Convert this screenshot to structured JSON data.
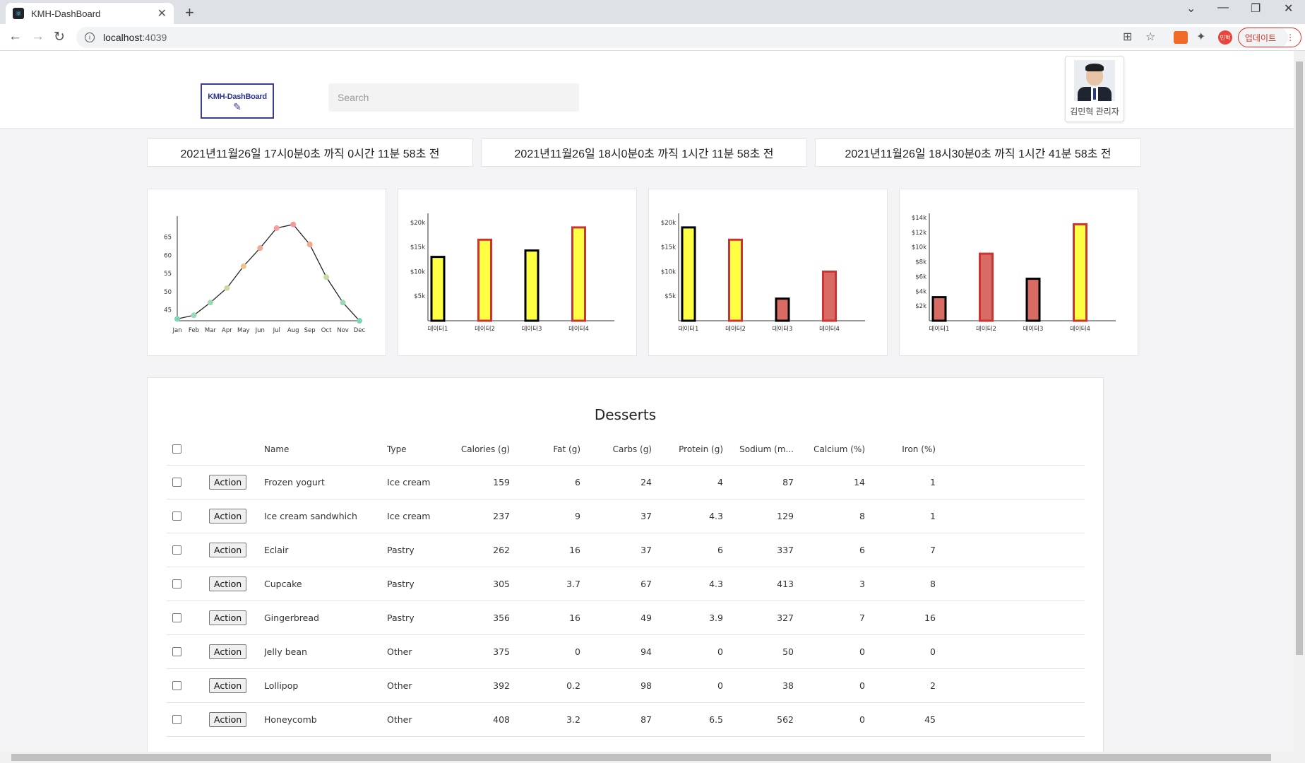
{
  "browser": {
    "tab_title": "KMH-DashBoard",
    "url_host": "localhost",
    "url_port": ":4039",
    "update_label": "업데이트",
    "profile_label": "민혁"
  },
  "header": {
    "logo_text": "KMH-DashBoard",
    "search_placeholder": "Search",
    "user_name": "김민혁 관리자"
  },
  "timers": [
    "2021년11월26일 17시0분0초 까직  0시간 11분 58초 전",
    "2021년11월26일 18시0분0초 까직  1시간 11분 58초 전",
    "2021년11월26일 18시30분0초 까직  1시간 41분 58초 전"
  ],
  "chart_data": [
    {
      "type": "line",
      "categories": [
        "Jan",
        "Feb",
        "Mar",
        "Apr",
        "May",
        "Jun",
        "Jul",
        "Aug",
        "Sep",
        "Oct",
        "Nov",
        "Dec"
      ],
      "values": [
        42.5,
        43.5,
        47,
        51,
        57,
        62,
        67.5,
        68.5,
        63,
        54,
        47,
        42
      ],
      "ylim": [
        42,
        70
      ],
      "yticks": [
        45,
        50,
        55,
        60,
        65
      ],
      "point_colors": [
        "#7ed6b2",
        "#9ad9b8",
        "#9fd8b4",
        "#c9dca0",
        "#f0c38c",
        "#f4a69a",
        "#f4a0a0",
        "#f09a9a",
        "#f0a88e",
        "#c9dca0",
        "#9fd8b4",
        "#7ed6b2"
      ]
    },
    {
      "type": "bar",
      "categories": [
        "데이터1",
        "데이터2",
        "데이터3",
        "데이터4"
      ],
      "values": [
        13000,
        16500,
        14300,
        19000
      ],
      "ylim": [
        0,
        21000
      ],
      "yticks": [
        [
          5000,
          "$5k"
        ],
        [
          10000,
          "$10k"
        ],
        [
          15000,
          "$15k"
        ],
        [
          20000,
          "$20k"
        ]
      ],
      "fills": [
        "#ffff44",
        "#ffff44",
        "#ffff44",
        "#ffff44"
      ],
      "strokes": [
        "#000000",
        "#cc3333",
        "#000000",
        "#cc3333"
      ]
    },
    {
      "type": "bar",
      "categories": [
        "데이터1",
        "데이터2",
        "데이터3",
        "데이터4"
      ],
      "values": [
        19000,
        16500,
        4500,
        10000
      ],
      "ylim": [
        0,
        21000
      ],
      "yticks": [
        [
          5000,
          "$5k"
        ],
        [
          10000,
          "$10k"
        ],
        [
          15000,
          "$15k"
        ],
        [
          20000,
          "$20k"
        ]
      ],
      "fills": [
        "#ffff44",
        "#ffff44",
        "#d86b63",
        "#d86b63"
      ],
      "strokes": [
        "#000000",
        "#cc3333",
        "#000000",
        "#cc3333"
      ]
    },
    {
      "type": "bar",
      "categories": [
        "데이터1",
        "데이터2",
        "데이터3",
        "데이터4"
      ],
      "values": [
        3200,
        9100,
        5700,
        13100
      ],
      "ylim": [
        0,
        14000
      ],
      "yticks": [
        [
          2000,
          "$2k"
        ],
        [
          4000,
          "$4k"
        ],
        [
          6000,
          "$6k"
        ],
        [
          8000,
          "$8k"
        ],
        [
          10000,
          "$10k"
        ],
        [
          12000,
          "$12k"
        ],
        [
          14000,
          "$14k"
        ]
      ],
      "fills": [
        "#d86b63",
        "#d86b63",
        "#d86b63",
        "#ffff44"
      ],
      "strokes": [
        "#000000",
        "#cc3333",
        "#000000",
        "#cc3333"
      ]
    }
  ],
  "table": {
    "title": "Desserts",
    "action_label": "Action",
    "columns": [
      "Name",
      "Type",
      "Calories (g)",
      "Fat (g)",
      "Carbs (g)",
      "Protein (g)",
      "Sodium (m...",
      "Calcium (%)",
      "Iron (%)"
    ],
    "rows": [
      [
        "Frozen yogurt",
        "Ice cream",
        "159",
        "6",
        "24",
        "4",
        "87",
        "14",
        "1"
      ],
      [
        "Ice cream sandwhich",
        "Ice cream",
        "237",
        "9",
        "37",
        "4.3",
        "129",
        "8",
        "1"
      ],
      [
        "Eclair",
        "Pastry",
        "262",
        "16",
        "37",
        "6",
        "337",
        "6",
        "7"
      ],
      [
        "Cupcake",
        "Pastry",
        "305",
        "3.7",
        "67",
        "4.3",
        "413",
        "3",
        "8"
      ],
      [
        "Gingerbread",
        "Pastry",
        "356",
        "16",
        "49",
        "3.9",
        "327",
        "7",
        "16"
      ],
      [
        "Jelly bean",
        "Other",
        "375",
        "0",
        "94",
        "0",
        "50",
        "0",
        "0"
      ],
      [
        "Lollipop",
        "Other",
        "392",
        "0.2",
        "98",
        "0",
        "38",
        "0",
        "2"
      ],
      [
        "Honeycomb",
        "Other",
        "408",
        "3.2",
        "87",
        "6.5",
        "562",
        "0",
        "45"
      ]
    ]
  }
}
